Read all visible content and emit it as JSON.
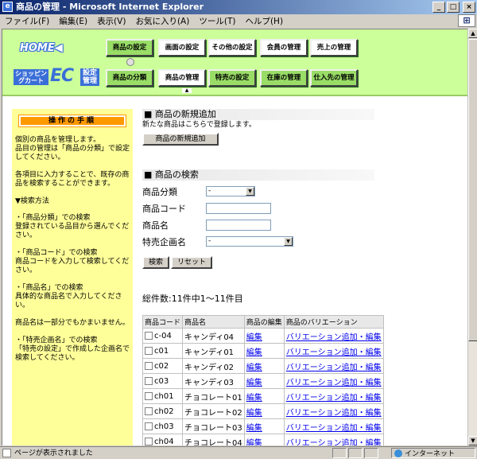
{
  "window": {
    "title": "商品の管理 - Microsoft Internet Explorer"
  },
  "menu": [
    "ファイル(F)",
    "編集(E)",
    "表示(V)",
    "お気に入り(A)",
    "ツール(T)",
    "ヘルプ(H)"
  ],
  "header": {
    "home_label": "HOME◀",
    "logo_cart": "ショッピングカート",
    "logo_ec": "EC",
    "logo_setting": "設定管理",
    "nav_top": [
      "商品の設定",
      "画面の設定",
      "その他の設定",
      "会員の管理",
      "売上の管理"
    ],
    "nav_bottom": [
      "商品の分類",
      "商品の管理",
      "特売の設定",
      "在庫の管理",
      "仕入先の管理"
    ],
    "active_top": "商品の設定"
  },
  "sidebar": {
    "heading": "操作の手順",
    "paragraphs": [
      "個別の商品を管理します。\n品目の管理は「商品の分類」で設定してください。",
      "各項目に入力することで、既存の商品を検索することができます。",
      "▼検索方法",
      "・「商品分類」での検索\n登録されている品目から選んでください。",
      "・「商品コード」での検索\n商品コードを入力して検索してください。",
      "・「商品名」での検索\n具体的な商品名で入力してください。",
      "商品名は一部分でもかまいません。",
      "・「特売企画名」での検索\n「特売の設定」で作成した企画名で検索してください。"
    ]
  },
  "main": {
    "add_section_title": "■ 商品の新規追加",
    "add_section_desc": "新たな商品はこちらで登録します。",
    "add_button": "商品の新規追加",
    "search_section_title": "■ 商品の検索",
    "search": {
      "category_label": "商品分類",
      "category_value": "-",
      "code_label": "商品コード",
      "code_value": "",
      "name_label": "商品名",
      "name_value": "",
      "sale_label": "特売企画名",
      "sale_value": "-",
      "search_button": "検索",
      "reset_button": "リセット"
    },
    "results_count": "総件数:11件中1〜11件目",
    "table": {
      "headers": [
        "商品コード",
        "商品名",
        "商品の編集",
        "商品のバリエーション"
      ],
      "rows": [
        {
          "code": "c-04",
          "name": "キャンディ04",
          "edit": "編集",
          "variation": "バリエーション追加・編集"
        },
        {
          "code": "c01",
          "name": "キャンディ01",
          "edit": "編集",
          "variation": "バリエーション追加・編集"
        },
        {
          "code": "c02",
          "name": "キャンディ02",
          "edit": "編集",
          "variation": "バリエーション追加・編集"
        },
        {
          "code": "c03",
          "name": "キャンディ03",
          "edit": "編集",
          "variation": "バリエーション追加・編集"
        },
        {
          "code": "ch01",
          "name": "チョコレート01",
          "edit": "編集",
          "variation": "バリエーション追加・編集"
        },
        {
          "code": "ch02",
          "name": "チョコレート02",
          "edit": "編集",
          "variation": "バリエーション追加・編集"
        },
        {
          "code": "ch03",
          "name": "チョコレート03",
          "edit": "編集",
          "variation": "バリエーション追加・編集"
        },
        {
          "code": "ch04",
          "name": "チョコレート04",
          "edit": "編集",
          "variation": "バリエーション追加・編集"
        }
      ]
    }
  },
  "status": {
    "message": "ページが表示されました",
    "zone": "インターネット"
  },
  "colors": {
    "header_bg": "#ccff99",
    "sidebar_bg": "#ffff99",
    "sidebar_head": "#ff9900",
    "link": "#0000ee"
  }
}
